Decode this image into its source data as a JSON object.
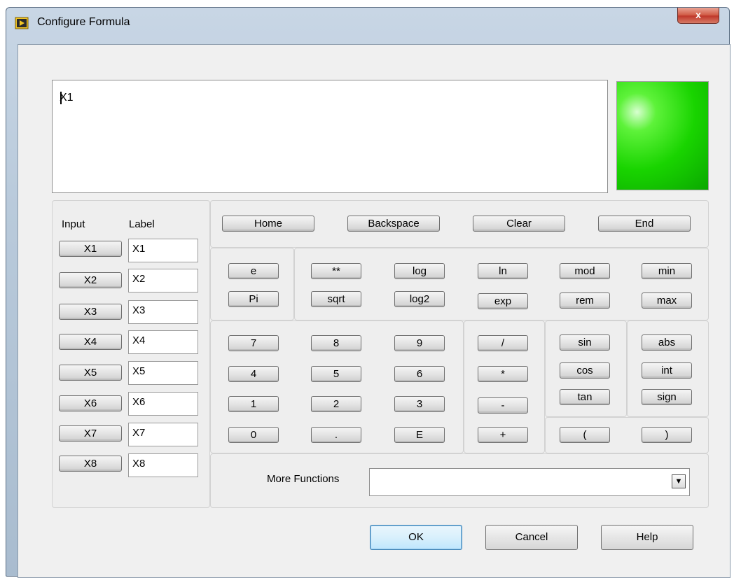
{
  "window": {
    "title": "Configure Formula",
    "close_label": "x"
  },
  "formula": {
    "value": "X1"
  },
  "inputs": {
    "input_header": "Input",
    "label_header": "Label",
    "rows": [
      {
        "button": "X1",
        "label": "X1"
      },
      {
        "button": "X2",
        "label": "X2"
      },
      {
        "button": "X3",
        "label": "X3"
      },
      {
        "button": "X4",
        "label": "X4"
      },
      {
        "button": "X5",
        "label": "X5"
      },
      {
        "button": "X6",
        "label": "X6"
      },
      {
        "button": "X7",
        "label": "X7"
      },
      {
        "button": "X8",
        "label": "X8"
      }
    ]
  },
  "nav": {
    "home": "Home",
    "backspace": "Backspace",
    "clear": "Clear",
    "end": "End"
  },
  "constants": {
    "e": "e",
    "pi": "Pi"
  },
  "functions": {
    "power": "**",
    "log": "log",
    "ln": "ln",
    "mod": "mod",
    "min": "min",
    "sqrt": "sqrt",
    "log2": "log2",
    "exp": "exp",
    "rem": "rem",
    "max": "max"
  },
  "digits": {
    "d7": "7",
    "d8": "8",
    "d9": "9",
    "d4": "4",
    "d5": "5",
    "d6": "6",
    "d1": "1",
    "d2": "2",
    "d3": "3",
    "d0": "0",
    "dot": ".",
    "exp_e": "E"
  },
  "operators": {
    "divide": "/",
    "multiply": "*",
    "minus": "-",
    "plus": "+"
  },
  "trig": {
    "sin": "sin",
    "cos": "cos",
    "tan": "tan"
  },
  "misc": {
    "abs": "abs",
    "int": "int",
    "sign": "sign",
    "lparen": "(",
    "rparen": ")"
  },
  "more_functions": {
    "label": "More Functions",
    "value": ""
  },
  "dialog": {
    "ok": "OK",
    "cancel": "Cancel",
    "help": "Help"
  },
  "colors": {
    "led": "#19d400",
    "title_bar": "#b9cadb",
    "close": "#c0392b"
  }
}
